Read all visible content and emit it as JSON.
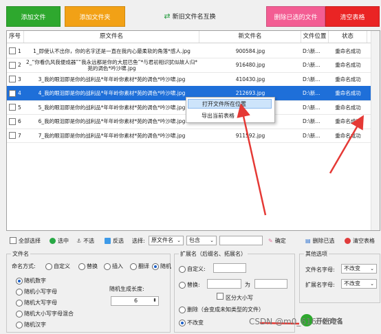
{
  "top_buttons": {
    "add_file": "添加文件",
    "add_folder": "添加文件夹",
    "swap": "新旧文件名互换",
    "delete_selected": "删除已选的文件",
    "clear_table": "清空表格"
  },
  "table": {
    "headers": [
      "序号",
      "原文件名",
      "新文件名",
      "文件位置",
      "状态"
    ],
    "rows": [
      {
        "index": "1",
        "original": "1_即使认不出你，你的名字还是一直在我内心最柔软的角落*感人.jpg",
        "new_name": "900584.jpg",
        "location": "D:\\新...",
        "status": "重命名成功"
      },
      {
        "index": "2",
        "original": "2_“你看仇风我便成器”“我永远都是你的大屁巴鱼”*与君初相识犹似故人归*苑的调色*吟沙啸.jpg",
        "new_name": "916480.jpg",
        "location": "D:\\新...",
        "status": "重命名成功"
      },
      {
        "index": "3",
        "original": "3_我的眼泪即是你的战利品*年年岭你素材*苑的调色*吟沙啸.jpg",
        "new_name": "410430.jpg",
        "location": "D:\\新...",
        "status": "重命名成功"
      },
      {
        "index": "4",
        "original": "4_我的眼泪即是你的战利品*年年岭你素材*苑的调色*吟沙啸.jpg",
        "new_name": "212693.jpg",
        "location": "D:\\新...",
        "status": "重命名成功"
      },
      {
        "index": "5",
        "original": "5_我的眼泪即是你的战利品*年年岭你素材*苑的调色*吟沙啸.jpg",
        "new_name": "",
        "location": "D:\\新...",
        "status": "重命名成功"
      },
      {
        "index": "6",
        "original": "6_我的眼泪即是你的战利品*年年岭你素材*苑的调色*吟沙啸.jpg",
        "new_name": "",
        "location": "D:\\新...",
        "status": "重命名成功"
      },
      {
        "index": "7",
        "original": "7_我的眼泪即是你的战利品*年年岭你素材*苑的调色*吟沙啸.jpg",
        "new_name": "911592.jpg",
        "location": "D:\\新...",
        "status": "重命名成功"
      }
    ]
  },
  "context_menu": {
    "open_location": "打开文件所在位置",
    "export_table": "导出当前表格"
  },
  "toolbar": {
    "select_all": "全部选择",
    "select_checked": "选中",
    "unselect": "不选",
    "invert": "反选",
    "select_label": "选择:",
    "field_value": "原文件名",
    "contains_value": "包含",
    "confirm": "确定",
    "delete_selected": "删除已选",
    "clear_table": "清空表格"
  },
  "filename_group": {
    "title": "文件名",
    "naming_label": "命名方式:",
    "modes": [
      "自定义",
      "替换",
      "插入",
      "翻译",
      "随机"
    ],
    "random_types": [
      "随机数字",
      "随机小写字母",
      "随机大写字母",
      "随机大小写字母混合",
      "随机汉字"
    ],
    "length_label": "随机生成长度:",
    "length_value": "6"
  },
  "extension_group": {
    "title": "扩展名（后缀名、拓展名）",
    "custom": "自定义:",
    "replace": "替换:",
    "to": "为",
    "case_sensitive": "区分大小写",
    "delete": "删除（会变成未知类型的文件）",
    "unchanged": "不改变"
  },
  "other_group": {
    "title": "其他选项",
    "filename_case_label": "文件名字母:",
    "filename_case_value": "不改变",
    "ext_case_label": "扩展名字母:",
    "ext_case_value": "不改变"
  },
  "start_button": "开始命名",
  "watermark": "CSDN @m0_61606524",
  "colors": {
    "green": "#2ea82e",
    "orange": "#f2a116",
    "pink": "#f35d93",
    "red": "#ea2424",
    "selection": "#1e6fd9",
    "arrow": "#e53935"
  }
}
